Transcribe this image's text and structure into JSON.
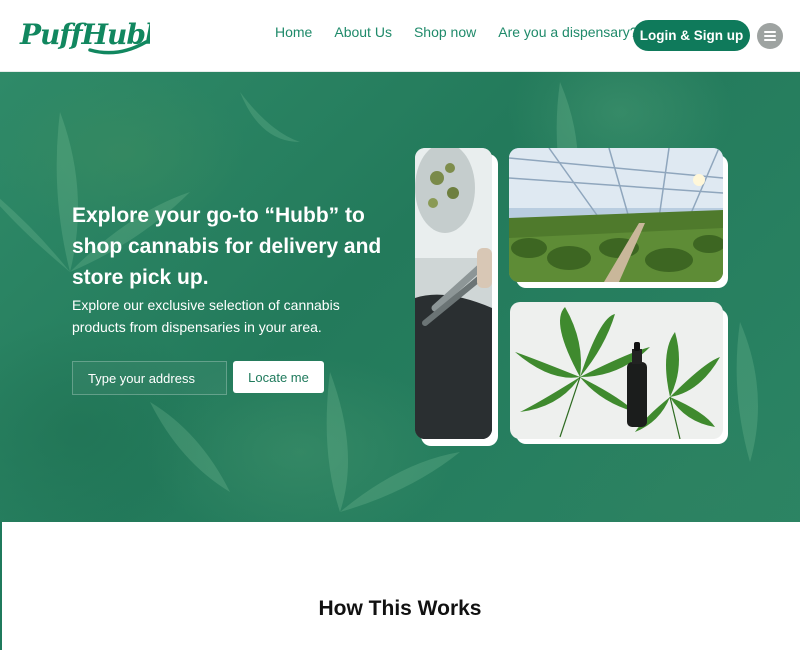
{
  "brand": {
    "logo_text": "PuffHubb",
    "accent": "#0f7a5b",
    "nav_text_color": "#1f8a6a"
  },
  "nav": {
    "items": [
      {
        "label": "Home"
      },
      {
        "label": "About Us"
      },
      {
        "label": "Shop now"
      },
      {
        "label": "Are you a dispensary?"
      }
    ],
    "login_label": "Login & Sign up",
    "menu_icon": "hamburger-menu-icon"
  },
  "hero": {
    "title": "Explore your go-to “Hubb” to shop cannabis for delivery and store pick up.",
    "subtitle": "Explore our exclusive selection of cannabis products from dispensaries in your area.",
    "address_placeholder": "Type your address",
    "locate_label": "Locate me"
  },
  "section": {
    "title": "How This Works"
  }
}
